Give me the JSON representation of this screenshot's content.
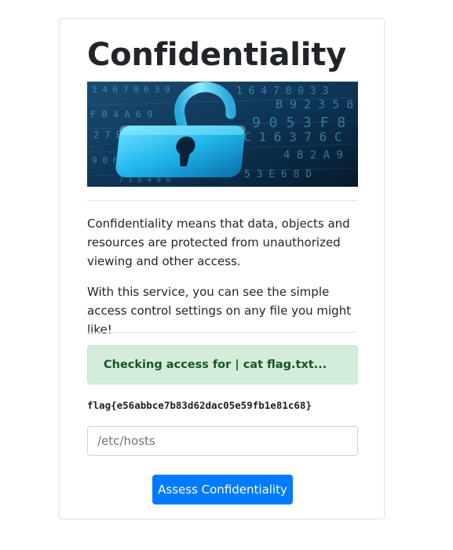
{
  "card": {
    "title": "Confidentiality",
    "hero_image": {
      "name": "padlock-data-image",
      "digits_text": "1 4 6 7 8 0 3 9 0 5 3 F 0 B 9 2 3 5 8 9 2 7 6 C 3"
    },
    "paragraph_1": "Confidentiality means that data, objects and resources are protected from unauthorized viewing and other access.",
    "paragraph_2": "With this service, you can see the simple access control settings on any file you might like!",
    "alert_text": "Checking access for | cat flag.txt...",
    "flag_output": "flag{e56abbce7b83d62dac05e59fb1e81c68}",
    "file_input": {
      "placeholder": "/etc/hosts",
      "value": ""
    },
    "submit_label": "Assess Confidentiality"
  },
  "colors": {
    "primary": "#007bff",
    "alert_bg": "#d4edda",
    "alert_text": "#155724",
    "hero_cyan": "#32c8ff"
  }
}
